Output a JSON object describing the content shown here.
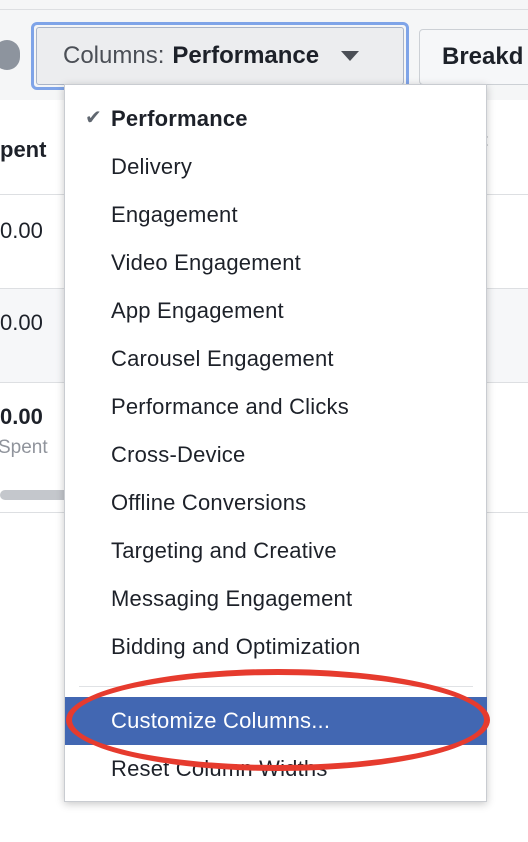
{
  "toolbar": {
    "columns_prefix": "Columns:",
    "columns_value": "Performance",
    "breakdown_label": "Breakd"
  },
  "table": {
    "header_partial": "pent",
    "rows": [
      {
        "value": "0.00",
        "sub": ""
      },
      {
        "value": "0.00",
        "sub": ""
      },
      {
        "value": "0.00",
        "sub": "Spent"
      }
    ]
  },
  "menu": {
    "items": [
      {
        "label": "Performance",
        "selected": true
      },
      {
        "label": "Delivery"
      },
      {
        "label": "Engagement"
      },
      {
        "label": "Video Engagement"
      },
      {
        "label": "App Engagement"
      },
      {
        "label": "Carousel Engagement"
      },
      {
        "label": "Performance and Clicks"
      },
      {
        "label": "Cross-Device"
      },
      {
        "label": "Offline Conversions"
      },
      {
        "label": "Targeting and Creative"
      },
      {
        "label": "Messaging Engagement"
      },
      {
        "label": "Bidding and Optimization"
      }
    ],
    "customize_label": "Customize Columns...",
    "reset_label": "Reset Column Widths"
  },
  "colors": {
    "highlight": "#4267b2",
    "annotation": "#e63b2e",
    "focus_ring": "#7fa4e8"
  },
  "icons": {
    "check": "checkmark-icon",
    "caret": "caret-down-icon"
  }
}
